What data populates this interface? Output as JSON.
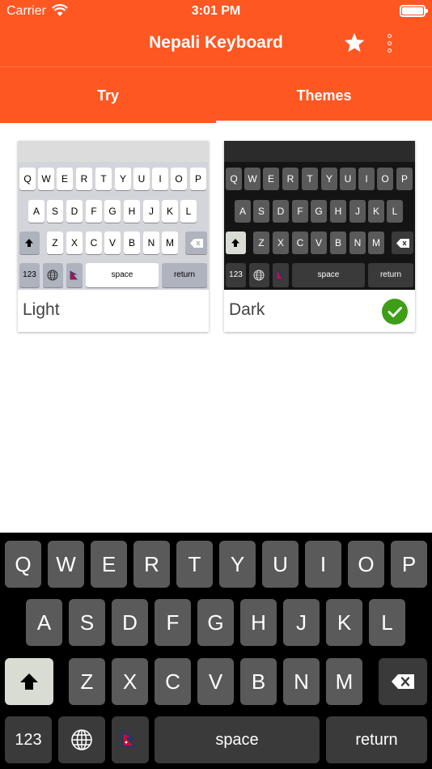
{
  "status": {
    "carrier": "Carrier",
    "time": "3:01 PM"
  },
  "app": {
    "title": "Nepali Keyboard"
  },
  "tabs": [
    {
      "label": "Try"
    },
    {
      "label": "Themes"
    }
  ],
  "themes": [
    {
      "name": "Light",
      "selected": false
    },
    {
      "name": "Dark",
      "selected": true
    }
  ],
  "keyboard": {
    "row1": [
      "Q",
      "W",
      "E",
      "R",
      "T",
      "Y",
      "U",
      "I",
      "O",
      "P"
    ],
    "row2": [
      "A",
      "S",
      "D",
      "F",
      "G",
      "H",
      "J",
      "K",
      "L"
    ],
    "row3": [
      "Z",
      "X",
      "C",
      "V",
      "B",
      "N",
      "M"
    ],
    "numbers_label": "123",
    "space_label": "space",
    "return_label": "return"
  },
  "colors": {
    "accent": "#ff5722",
    "selected_check": "#3f9e17",
    "dark_key": "#5a5a5a",
    "dark_special_key": "#3a3a3a",
    "dark_background": "#000000"
  }
}
